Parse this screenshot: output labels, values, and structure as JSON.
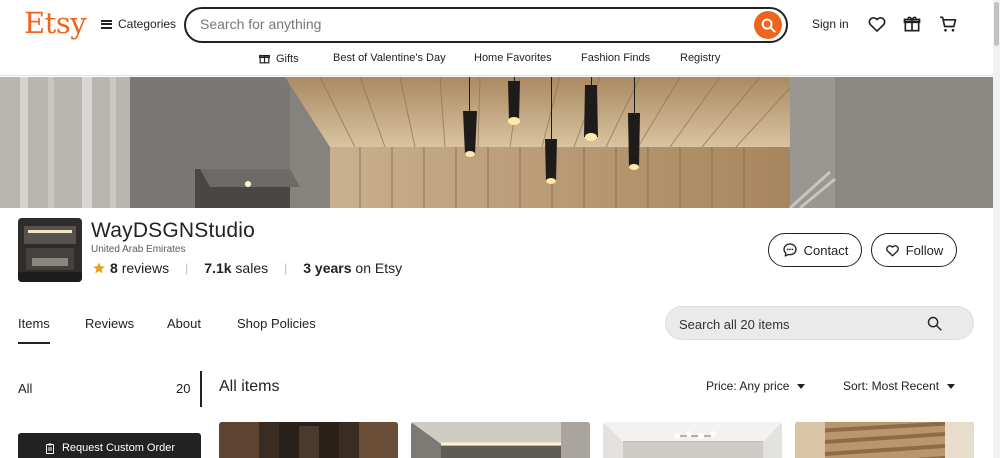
{
  "header": {
    "logo": "Etsy",
    "categories_label": "Categories",
    "search_placeholder": "Search for anything",
    "signin_label": "Sign in",
    "brand_color": "#f1641e",
    "icons": [
      "search-icon",
      "heart-icon",
      "gift-icon",
      "cart-icon"
    ]
  },
  "subnav": {
    "items": [
      {
        "label": "Gifts",
        "icon": "gift-icon"
      },
      {
        "label": "Best of Valentine's Day"
      },
      {
        "label": "Home Favorites"
      },
      {
        "label": "Fashion Finds"
      },
      {
        "label": "Registry"
      }
    ]
  },
  "shop": {
    "name": "WayDSGNStudio",
    "location": "United Arab Emirates",
    "reviews_count": "8",
    "reviews_label": "reviews",
    "sales_count": "7.1k",
    "sales_label": "sales",
    "years_count": "3 years",
    "years_label": "on Etsy",
    "contact_label": "Contact",
    "follow_label": "Follow",
    "star_color": "#e8a317"
  },
  "tabs": [
    {
      "label": "Items",
      "active": true
    },
    {
      "label": "Reviews"
    },
    {
      "label": "About"
    },
    {
      "label": "Shop Policies"
    }
  ],
  "items_search": {
    "placeholder": "Search all 20 items"
  },
  "sidebar": {
    "all_label": "All",
    "all_count": "20",
    "request_label": "Request Custom Order"
  },
  "content": {
    "title": "All items",
    "price_filter": "Price: Any price",
    "sort": "Sort: Most Recent"
  }
}
